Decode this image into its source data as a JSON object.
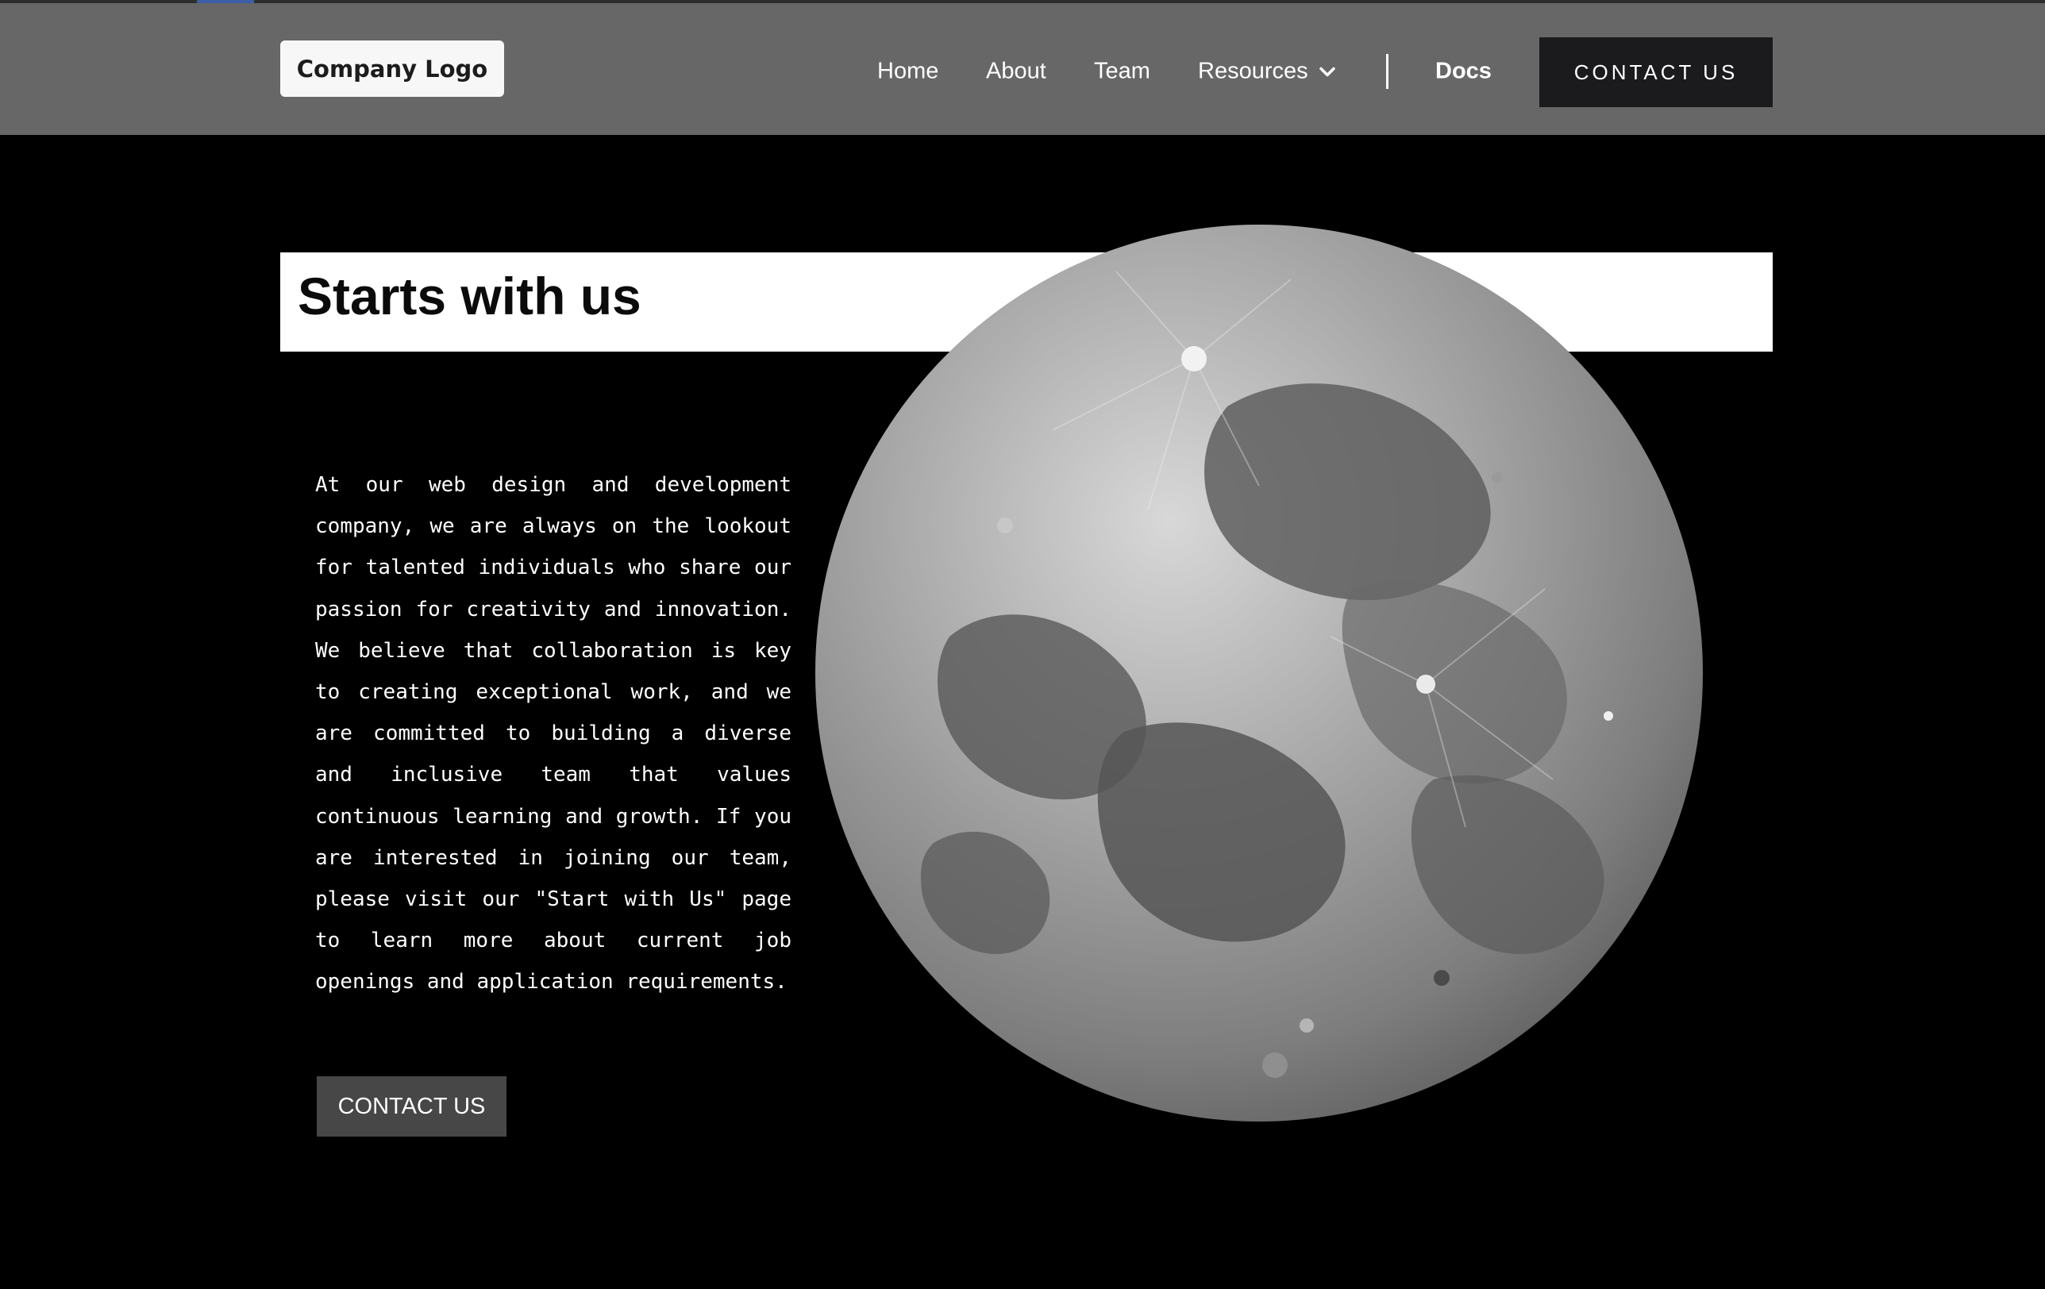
{
  "header": {
    "logo_label": "Company Logo",
    "nav": {
      "home": "Home",
      "about": "About",
      "team": "Team",
      "resources": "Resources",
      "docs": "Docs"
    },
    "contact_label": "CONTACT US"
  },
  "hero": {
    "title": "Starts with us",
    "paragraph": "At our web design and development company, we are always on the lookout for talented individuals who share our passion for creativity and innovation. We believe that collaboration is key to creating exceptional work, and we are committed to building a diverse and inclusive team that values continuous learning and growth. If you are interested in joining our team, please visit our \"Start with Us\" page to learn more about current job openings and application requirements.",
    "contact_label": "CONTACT US"
  },
  "icons": {
    "resources_dropdown": "chevron-down-icon",
    "hero_image": "moon-image"
  },
  "colors": {
    "navbar_bg": "#676767",
    "page_bg": "#000000",
    "nav_contact_bg": "#1b1b1d",
    "hero_contact_bg": "#474747"
  }
}
